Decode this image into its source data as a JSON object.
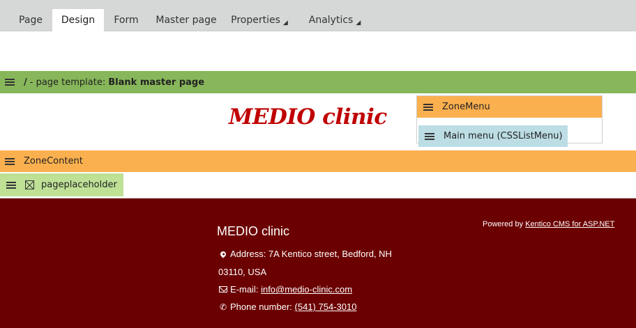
{
  "tabs": [
    {
      "label": "Page",
      "active": false,
      "has_menu": false
    },
    {
      "label": "Design",
      "active": true,
      "has_menu": false
    },
    {
      "label": "Form",
      "active": false,
      "has_menu": false
    },
    {
      "label": "Master page",
      "active": false,
      "has_menu": false
    },
    {
      "label": "Properties",
      "active": false,
      "has_menu": true
    },
    {
      "label": "Analytics",
      "active": false,
      "has_menu": true
    }
  ],
  "template_bar": {
    "path": "/",
    "prefix": "- page template:",
    "template_name": "Blank master page"
  },
  "header": {
    "logo_text": "MEDIO clinic"
  },
  "zone_menu": {
    "label": "ZoneMenu",
    "widget_label": "Main menu (CSSListMenu)"
  },
  "zone_content": {
    "label": "ZoneContent",
    "widget_label": "pageplaceholder"
  },
  "footer": {
    "title": "MEDIO clinic",
    "address_line1": "Address: 7A Kentico street, Bedford, NH",
    "address_line2": "03110, USA",
    "email_label": "E-mail:",
    "email_link": "info@medio-clinic.com",
    "phone_label": "Phone number:",
    "phone_link": "(541) 754-3010",
    "powered_prefix": "Powered by",
    "powered_link": "Kentico CMS for ASP.NET"
  },
  "colors": {
    "tabbar_bg": "#d6d8d7",
    "template_bar_bg": "#87b75a",
    "zone_bg": "#fbb04f",
    "menu_widget_bg": "#bcdde4",
    "placeholder_widget_bg": "#bee196",
    "logo_color": "#c00000",
    "footer_bg": "#6b0000"
  },
  "icons": {
    "drag_handle": "hamburger-icon",
    "placeholder": "x-box-icon",
    "address": "map-pin-icon",
    "email": "envelope-icon",
    "phone": "phone-icon",
    "menu_caret": "caret-down-icon"
  }
}
